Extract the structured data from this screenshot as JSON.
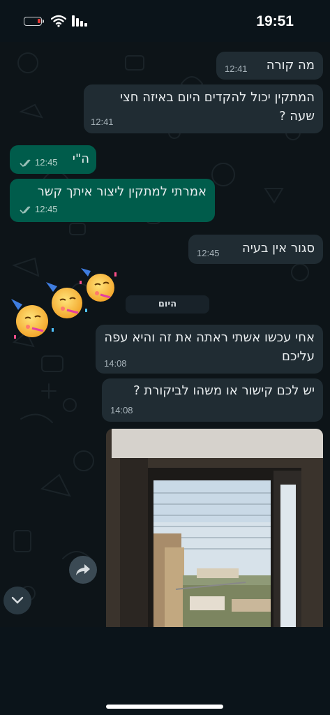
{
  "status_bar": {
    "time": "19:51",
    "icons": [
      "battery-low-icon",
      "wifi-icon",
      "signal-icon"
    ],
    "battery_color": "#e53935"
  },
  "theme": {
    "incoming_bubble": "#202c33",
    "outgoing_bubble": "#005c4b",
    "background": "#0b141a"
  },
  "messages": [
    {
      "direction": "incoming",
      "text": "מה קורה",
      "time": "12:41"
    },
    {
      "direction": "incoming",
      "text": "המתקין יכול להקדים היום  באיזה חצי שעה ?",
      "time": "12:41"
    },
    {
      "direction": "outgoing",
      "text": "ה\"י",
      "time": "12:45",
      "status": "read"
    },
    {
      "direction": "outgoing",
      "text": "אמרתי למתקין ליצור איתך קשר",
      "time": "12:45",
      "status": "read"
    },
    {
      "direction": "incoming",
      "text": "סגור אין בעיה",
      "time": "12:45"
    },
    {
      "direction": "incoming",
      "text": "אחי עכשו אשתי ראתה את זה והיא עפה עליכם",
      "time": "14:08"
    },
    {
      "direction": "incoming",
      "text": "יש לכם קישור או  משהו לביקורת ?",
      "time": "14:08"
    }
  ],
  "date_separator": "היום",
  "sticker": {
    "emoji": "partying-face",
    "count": 3
  },
  "photo_message": {
    "direction": "incoming",
    "subject": "window-view-photo"
  },
  "buttons": {
    "forward": "forward-icon",
    "scroll_down": "chevron-down-icon"
  }
}
